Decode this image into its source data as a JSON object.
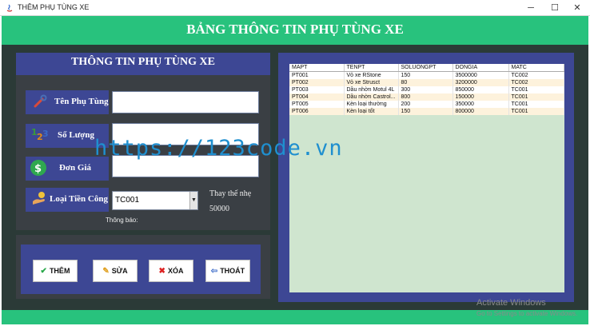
{
  "window": {
    "title": "THÊM PHỤ TÙNG XE",
    "minimize": "─",
    "maximize": "☐",
    "close": "✕"
  },
  "header": {
    "title": "BẢNG THÔNG TIN PHỤ TÙNG XE"
  },
  "form": {
    "title": "THÔNG TIN PHỤ TÙNG XE",
    "ten_label": "Tên Phụ Tùng",
    "ten_value": "",
    "soluong_label": "Số Lượng",
    "soluong_value": "",
    "dongia_label": "Đơn Giá",
    "dongia_value": "",
    "loai_label": "Loại Tiền Công",
    "loai_selected": "TC001",
    "info_line1": "Thay thế nhẹ",
    "info_line2": "50000",
    "thongbao": "Thông báo:"
  },
  "buttons": {
    "them": "THÊM",
    "sua": "SỬA",
    "xoa": "XÓA",
    "thoat": "THOÁT"
  },
  "table": {
    "columns": [
      "MAPT",
      "TENPT",
      "SOLUONGPT",
      "DONGIA",
      "MATC"
    ],
    "rows": [
      [
        "PT001",
        "Vỏ xe RStone",
        "150",
        "3500000",
        "TC002"
      ],
      [
        "PT002",
        "Vỏ xe Strusct",
        "80",
        "3200000",
        "TC002"
      ],
      [
        "PT003",
        "Dầu nhờn Motul 4L",
        "300",
        "850000",
        "TC001"
      ],
      [
        "PT004",
        "Dầu nhờn Castrol...",
        "800",
        "150000",
        "TC001"
      ],
      [
        "PT005",
        "Kèn loại thường",
        "200",
        "350000",
        "TC001"
      ],
      [
        "PT006",
        "Kèn loại tốt",
        "150",
        "800000",
        "TC001"
      ]
    ]
  },
  "watermark": "https://123code.vn",
  "os_notice": {
    "line1": "Activate Windows",
    "line2": "Go to Settings to activate Windows."
  },
  "colors": {
    "accent_green": "#28c27d",
    "panel_blue": "#3d4794",
    "dark_bg": "#2b3a37",
    "table_bg": "#cfe5cf"
  }
}
